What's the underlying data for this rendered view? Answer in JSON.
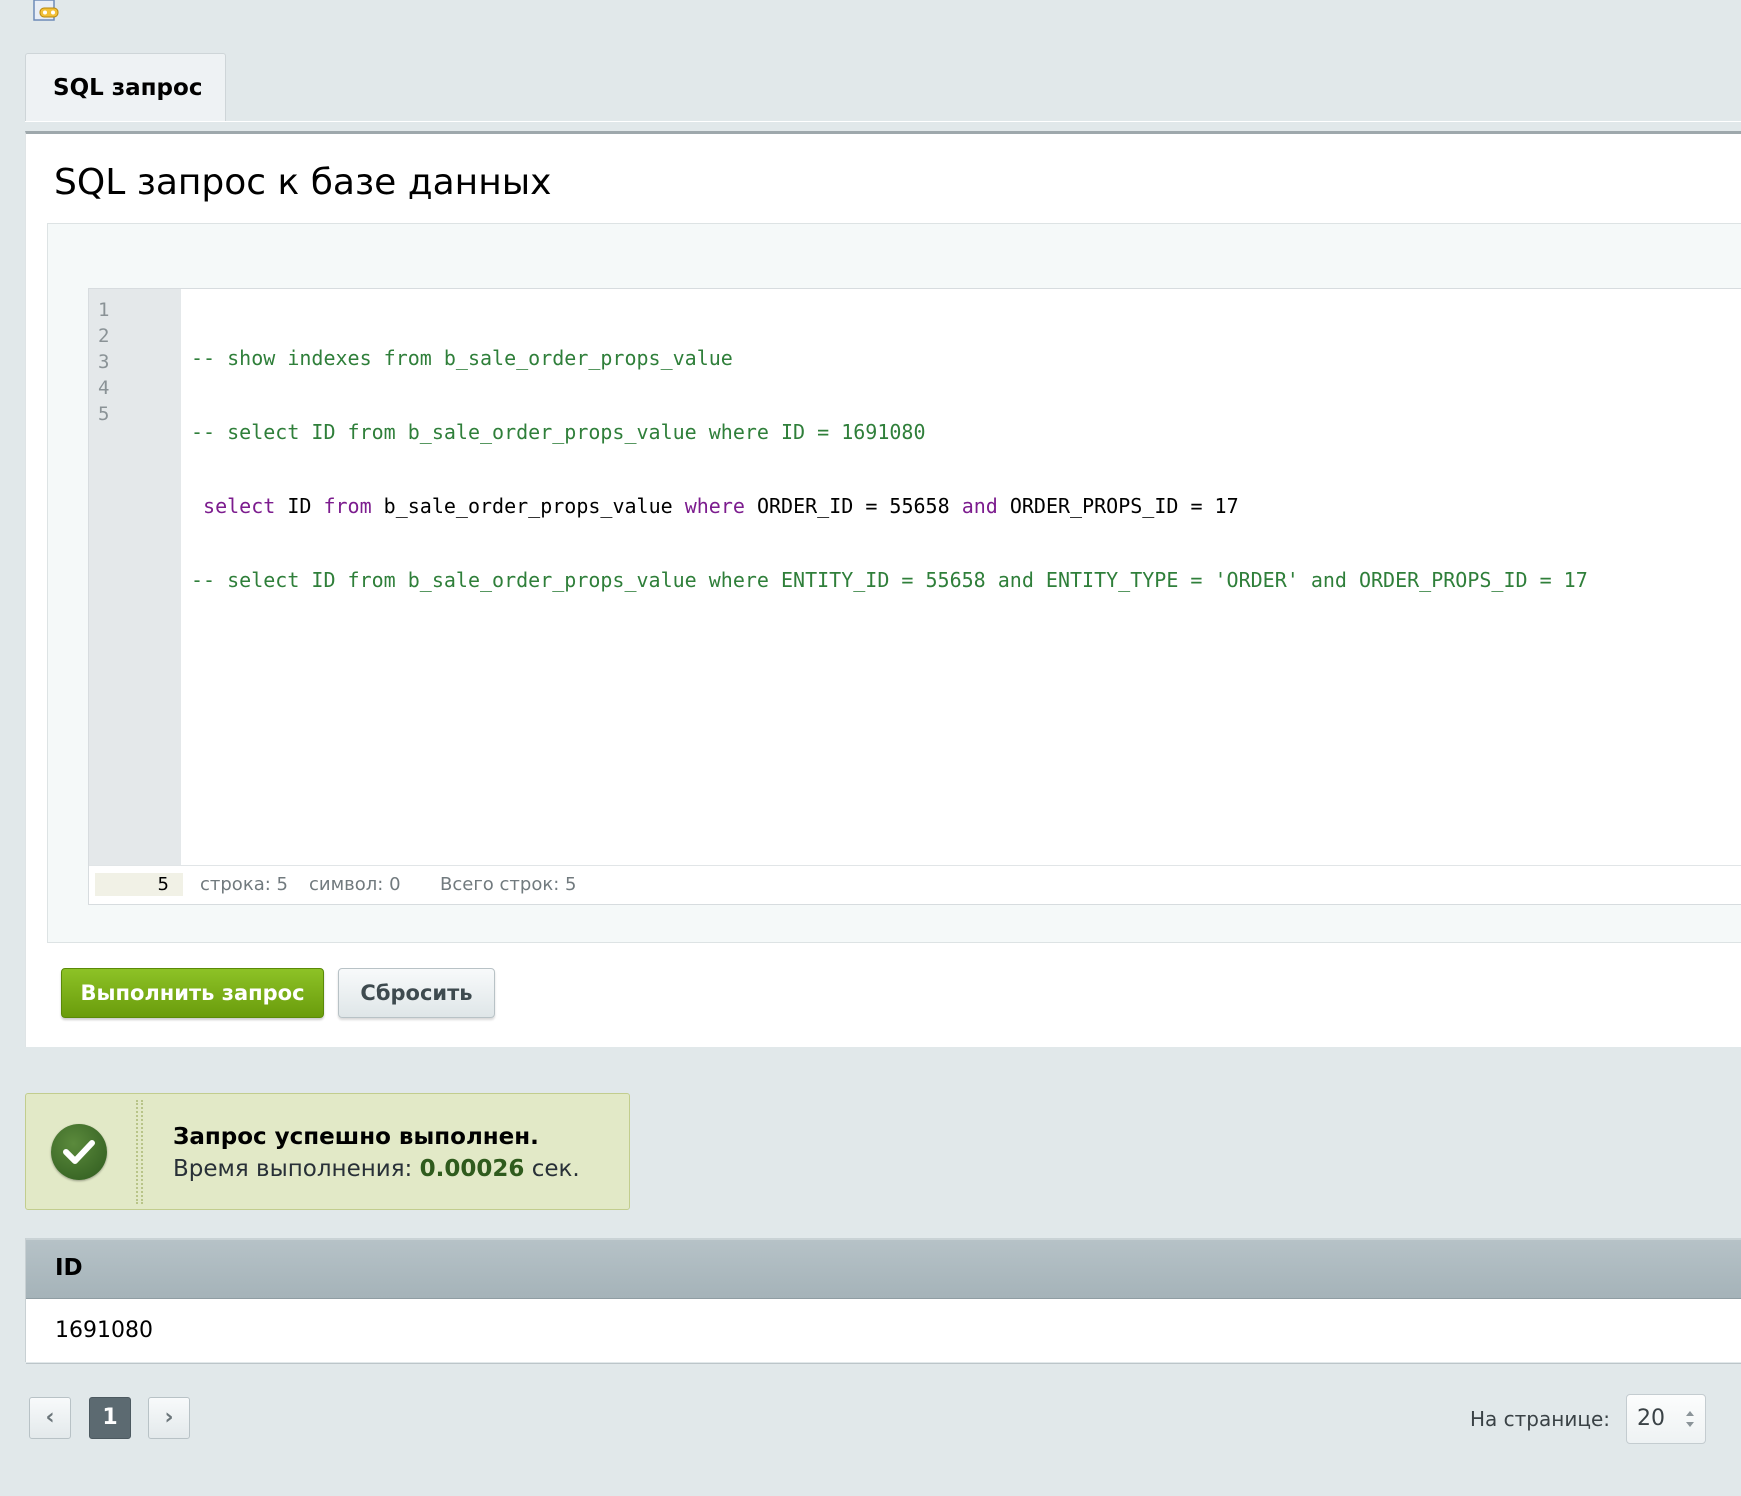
{
  "tab": {
    "label": "SQL запрос"
  },
  "panel": {
    "title": "SQL запрос к базе данных"
  },
  "editor": {
    "line_numbers": [
      "1",
      "2",
      "3",
      "4",
      "5"
    ],
    "lines": [
      "-- show indexes from b_sale_order_props_value",
      "-- select ID from b_sale_order_props_value where ID = 1691080",
      " select ID from b_sale_order_props_value where ORDER_ID = 55658 and ORDER_PROPS_ID = 17",
      "-- select ID from b_sale_order_props_value where ENTITY_ID = 55658 and ENTITY_TYPE = 'ORDER' and ORDER_PROPS_ID = 17",
      ""
    ],
    "line3_tokens": {
      "select": " select",
      "id": " ID ",
      "from": "from",
      "table": " b_sale_order_props_value ",
      "where": "where",
      "cond1": " ORDER_ID = 55658 ",
      "and": "and",
      "cond2": " ORDER_PROPS_ID = 17"
    },
    "status": {
      "current_line": "5",
      "row": "строка: 5",
      "col": "символ: 0",
      "total": "Всего строк: 5"
    }
  },
  "buttons": {
    "run": "Выполнить запрос",
    "reset": "Сбросить"
  },
  "message": {
    "title": "Запрос успешно выполнен.",
    "time_prefix": "Время выполнения: ",
    "time_value": "0.00026",
    "time_suffix": " сек."
  },
  "results": {
    "columns": [
      "ID"
    ],
    "rows": [
      [
        "1691080"
      ]
    ]
  },
  "pagination": {
    "prev": "‹",
    "current": "1",
    "next": "›",
    "per_page_label": "На странице:",
    "per_page_value": "20"
  },
  "colors": {
    "comment": "#2f7f3a",
    "keyword": "#7c1c8e",
    "run_button": "#7aae18",
    "success_bg": "#e2e9c7"
  }
}
